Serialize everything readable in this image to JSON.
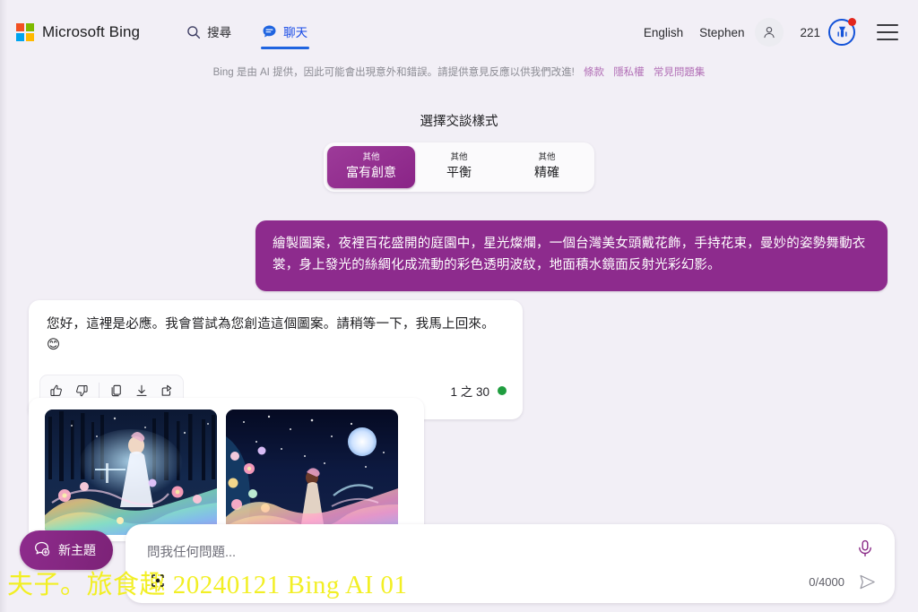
{
  "header": {
    "brand": "Microsoft Bing",
    "nav": [
      {
        "label": "搜尋",
        "icon": "search-icon",
        "active": false
      },
      {
        "label": "聊天",
        "icon": "chat-bubble-icon",
        "active": true
      }
    ],
    "language": "English",
    "user_name": "Stephen",
    "rewards_count": "221",
    "avatar_icon": "person-icon",
    "rewards_icon": "rewards-medal-icon",
    "menu_icon": "hamburger-icon"
  },
  "disclaimer": {
    "text": "Bing 是由 AI 提供，因此可能會出現意外和錯誤。請提供意見反應以供我們改進!",
    "links": [
      "條款",
      "隱私權",
      "常見問題集"
    ]
  },
  "style_selector": {
    "title": "選擇交談樣式",
    "options": [
      {
        "sup": "其他",
        "main": "富有創意",
        "selected": true
      },
      {
        "sup": "其他",
        "main": "平衡",
        "selected": false
      },
      {
        "sup": "其他",
        "main": "精確",
        "selected": false
      }
    ]
  },
  "conversation": {
    "user_message": "繪製圖案，夜裡百花盛開的庭園中，星光燦爛，一個台灣美女頭戴花飾，手持花束，曼妙的姿勢舞動衣裳，身上發光的絲綢化成流動的彩色透明波紋，地面積水鏡面反射光彩幻影。",
    "bot_message": "您好，這裡是必應。我會嘗試為您創造這個圖案。請稍等一下，我馬上回來。 😊",
    "actions": [
      {
        "name": "thumbs-up-icon",
        "label": "讚"
      },
      {
        "name": "thumbs-down-icon",
        "label": "不讚"
      },
      {
        "name": "copy-icon",
        "label": "複製"
      },
      {
        "name": "download-icon",
        "label": "下載"
      },
      {
        "name": "share-icon",
        "label": "分享"
      }
    ],
    "counter": "1 之 30",
    "status_color": "#1f9d3f",
    "images": [
      {
        "alt": "夜間花園中身穿彩色飄逸長裙的女子與湖景"
      },
      {
        "alt": "星空與滿月下身穿彩色波紋長裙的女子"
      }
    ]
  },
  "composer": {
    "new_topic_label": "新主題",
    "new_topic_icon": "new-chat-icon",
    "placeholder": "問我任何問題...",
    "char_count": "0/4000",
    "mic_icon": "microphone-icon",
    "send_icon": "send-arrow-icon"
  },
  "watermark": "夫子。旅食趣 20240121 Bing AI 01",
  "colors": {
    "accent_purple": "#8d2b8d",
    "nav_blue": "#1f64e0",
    "background": "#f2eff6",
    "notification_red": "#e3261c",
    "watermark_yellow": "#f2ef24"
  }
}
